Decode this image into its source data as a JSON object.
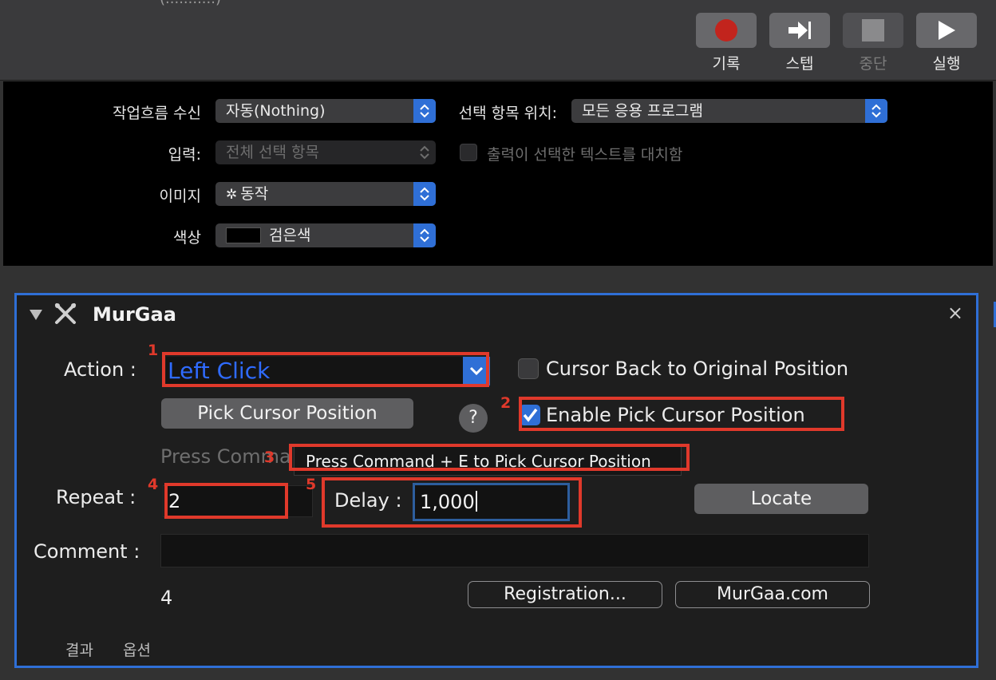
{
  "toolbar": {
    "title_fragment": "(...........)",
    "buttons": [
      {
        "label": "기록",
        "icon": "record-icon",
        "enabled": true
      },
      {
        "label": "스텝",
        "icon": "step-icon",
        "enabled": true
      },
      {
        "label": "중단",
        "icon": "stop-icon",
        "enabled": false
      },
      {
        "label": "실행",
        "icon": "play-icon",
        "enabled": true
      }
    ]
  },
  "settings": {
    "workflow_receives_label": "작업흐름 수신",
    "workflow_receives_value": "자동(Nothing)",
    "selection_location_label": "선택 항목 위치:",
    "selection_location_value": "모든 응용 프로그램",
    "input_label": "입력:",
    "input_value": "전체 선택 항목",
    "replace_output_label": "출력이 선택한 텍스트를 대치함",
    "image_label": "이미지",
    "image_value": "동작",
    "color_label": "색상",
    "color_value": "검은색",
    "color_swatch": "#000000"
  },
  "panel": {
    "title": "MurGaa",
    "close_glyph": "×",
    "action_label": "Action :",
    "action_value": "Left Click",
    "cursor_back_label": "Cursor Back to Original Position",
    "pick_cursor_button": "Pick Cursor Position",
    "help_glyph": "?",
    "enable_pick_label": "Enable Pick Cursor Position",
    "enable_pick_checked": true,
    "press_command_hint": "Press Comma",
    "tooltip": "Press Command + E to Pick Cursor Position",
    "repeat_label": "Repeat :",
    "repeat_value": "2",
    "delay_label": "Delay :",
    "delay_value": "1,000",
    "locate_button": "Locate",
    "comment_label": "Comment :",
    "comment_value": "",
    "footer_number": "4",
    "registration_button": "Registration...",
    "website_button": "MurGaa.com",
    "tabs": [
      "결과",
      "옵션"
    ]
  },
  "annotations": [
    "1",
    "2",
    "3",
    "4",
    "5"
  ],
  "colors": {
    "accent": "#2f6fd6",
    "annotation_red": "#e0392b",
    "record_red": "#c2241d"
  }
}
